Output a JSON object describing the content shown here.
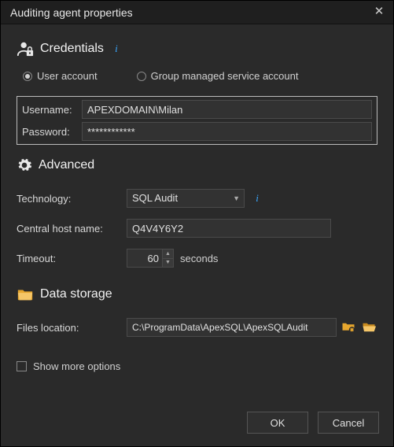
{
  "window": {
    "title": "Auditing agent properties"
  },
  "sections": {
    "credentials": {
      "heading": "Credentials",
      "account_type": {
        "user_label": "User account",
        "gmsa_label": "Group managed service account",
        "selected": "user"
      },
      "username_label": "Username:",
      "username_value": "APEXDOMAIN\\Milan",
      "password_label": "Password:",
      "password_value": "************"
    },
    "advanced": {
      "heading": "Advanced",
      "technology_label": "Technology:",
      "technology_value": "SQL Audit",
      "host_label": "Central host name:",
      "host_value": "Q4V4Y6Y2",
      "timeout_label": "Timeout:",
      "timeout_value": "60",
      "timeout_unit": "seconds"
    },
    "storage": {
      "heading": "Data storage",
      "files_label": "Files location:",
      "files_value": "C:\\ProgramData\\ApexSQL\\ApexSQLAudit"
    }
  },
  "show_more_label": "Show more options",
  "buttons": {
    "ok": "OK",
    "cancel": "Cancel"
  },
  "icons": {
    "credentials": "user-lock-icon",
    "advanced": "gear-icon",
    "storage": "folder-icon",
    "info": "info-icon",
    "open_network": "folder-network-icon",
    "browse": "folder-open-icon"
  }
}
